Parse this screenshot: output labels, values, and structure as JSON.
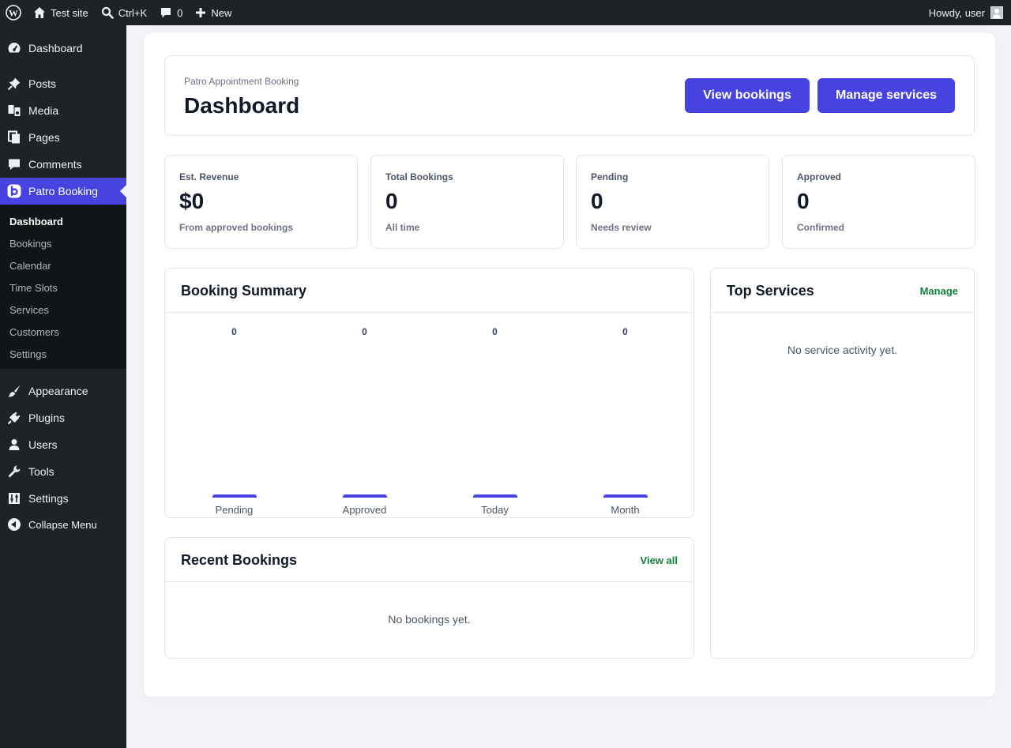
{
  "adminbar": {
    "site_name": "Test site",
    "search_shortcut": "Ctrl+K",
    "comments_count": "0",
    "new_label": "New",
    "howdy": "Howdy, user"
  },
  "sidebar": {
    "items": [
      {
        "label": "Dashboard",
        "icon": "dashboard-icon"
      },
      {
        "label": "Posts",
        "icon": "pin-icon"
      },
      {
        "label": "Media",
        "icon": "media-icon"
      },
      {
        "label": "Pages",
        "icon": "pages-icon"
      },
      {
        "label": "Comments",
        "icon": "comment-icon"
      },
      {
        "label": "Patro Booking",
        "icon": "patro-logo-icon"
      },
      {
        "label": "Appearance",
        "icon": "brush-icon"
      },
      {
        "label": "Plugins",
        "icon": "plug-icon"
      },
      {
        "label": "Users",
        "icon": "user-icon"
      },
      {
        "label": "Tools",
        "icon": "wrench-icon"
      },
      {
        "label": "Settings",
        "icon": "sliders-icon"
      }
    ],
    "submenu": [
      "Dashboard",
      "Bookings",
      "Calendar",
      "Time Slots",
      "Services",
      "Customers",
      "Settings"
    ],
    "collapse_label": "Collapse Menu"
  },
  "header": {
    "plugin_name": "Patro Appointment Booking",
    "title": "Dashboard",
    "view_bookings": "View bookings",
    "manage_services": "Manage services"
  },
  "stats": [
    {
      "label": "Est. Revenue",
      "value": "$0",
      "sub": "From approved bookings"
    },
    {
      "label": "Total Bookings",
      "value": "0",
      "sub": "All time"
    },
    {
      "label": "Pending",
      "value": "0",
      "sub": "Needs review"
    },
    {
      "label": "Approved",
      "value": "0",
      "sub": "Confirmed"
    }
  ],
  "summary": {
    "title": "Booking Summary"
  },
  "chart_data": {
    "type": "bar",
    "categories": [
      "Pending",
      "Approved",
      "Today",
      "Month"
    ],
    "values": [
      0,
      0,
      0,
      0
    ],
    "title": "Booking Summary",
    "bar_color": "#4743e0"
  },
  "top_services": {
    "title": "Top Services",
    "link": "Manage",
    "empty": "No service activity yet."
  },
  "recent": {
    "title": "Recent Bookings",
    "link": "View all",
    "empty": "No bookings yet."
  },
  "colors": {
    "accent": "#4743e0",
    "link_green": "#15803d",
    "admin_dark": "#1d2327"
  }
}
